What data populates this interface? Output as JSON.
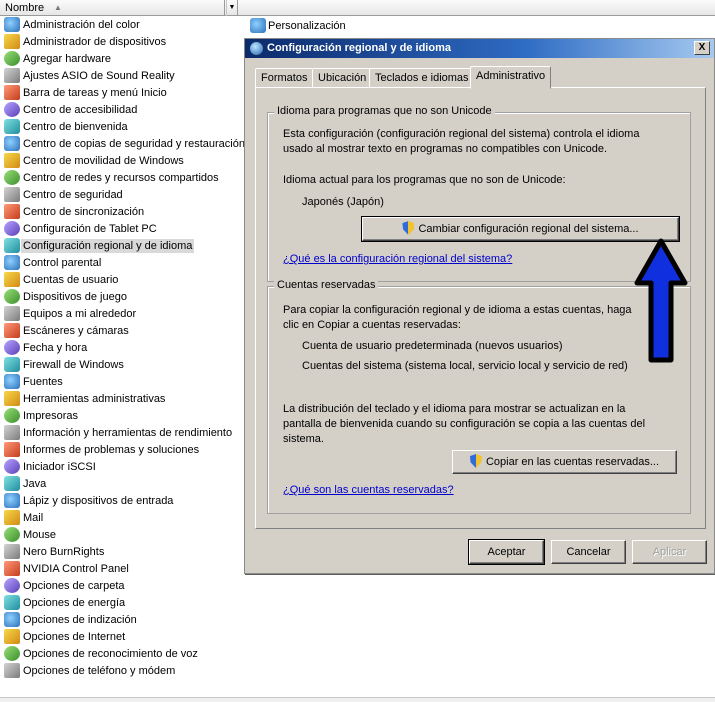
{
  "column_header": {
    "name_label": "Nombre",
    "sort_indicator": "▲",
    "dropdown_glyph": "▼"
  },
  "explorer_items": [
    {
      "label": "Administración del color",
      "icon": "color-icon"
    },
    {
      "label": "Administrador de dispositivos",
      "icon": "device-manager-icon"
    },
    {
      "label": "Agregar hardware",
      "icon": "add-hardware-icon"
    },
    {
      "label": "Ajustes ASIO de Sound Reality",
      "icon": "asio-icon"
    },
    {
      "label": "Barra de tareas y menú Inicio",
      "icon": "taskbar-icon"
    },
    {
      "label": "Centro de accesibilidad",
      "icon": "accessibility-icon"
    },
    {
      "label": "Centro de bienvenida",
      "icon": "welcome-icon"
    },
    {
      "label": "Centro de copias de seguridad y restauración",
      "icon": "backup-icon"
    },
    {
      "label": "Centro de movilidad de Windows",
      "icon": "mobility-icon"
    },
    {
      "label": "Centro de redes y recursos compartidos",
      "icon": "network-icon"
    },
    {
      "label": "Centro de seguridad",
      "icon": "security-icon"
    },
    {
      "label": "Centro de sincronización",
      "icon": "sync-icon"
    },
    {
      "label": "Configuración de Tablet PC",
      "icon": "tablet-icon"
    },
    {
      "label": "Configuración regional y de idioma",
      "icon": "globe-icon",
      "selected": true
    },
    {
      "label": "Control parental",
      "icon": "parental-icon"
    },
    {
      "label": "Cuentas de usuario",
      "icon": "users-icon"
    },
    {
      "label": "Dispositivos de juego",
      "icon": "gamepad-icon"
    },
    {
      "label": "Equipos a mi alrededor",
      "icon": "people-near-icon"
    },
    {
      "label": "Escáneres y cámaras",
      "icon": "scanner-icon"
    },
    {
      "label": "Fecha y hora",
      "icon": "clock-icon"
    },
    {
      "label": "Firewall de Windows",
      "icon": "firewall-icon"
    },
    {
      "label": "Fuentes",
      "icon": "fonts-icon"
    },
    {
      "label": "Herramientas administrativas",
      "icon": "admin-tools-icon"
    },
    {
      "label": "Impresoras",
      "icon": "printer-icon"
    },
    {
      "label": "Información y herramientas de rendimiento",
      "icon": "performance-icon"
    },
    {
      "label": "Informes de problemas y soluciones",
      "icon": "problem-reports-icon"
    },
    {
      "label": "Iniciador iSCSI",
      "icon": "iscsi-icon"
    },
    {
      "label": "Java",
      "icon": "java-icon"
    },
    {
      "label": "Lápiz y dispositivos de entrada",
      "icon": "pen-icon"
    },
    {
      "label": "Mail",
      "icon": "mail-icon"
    },
    {
      "label": "Mouse",
      "icon": "mouse-icon"
    },
    {
      "label": "Nero BurnRights",
      "icon": "nero-icon"
    },
    {
      "label": "NVIDIA Control Panel",
      "icon": "nvidia-icon"
    },
    {
      "label": "Opciones de carpeta",
      "icon": "folder-icon"
    },
    {
      "label": "Opciones de energía",
      "icon": "power-icon"
    },
    {
      "label": "Opciones de indización",
      "icon": "indexing-icon"
    },
    {
      "label": "Opciones de Internet",
      "icon": "internet-icon"
    },
    {
      "label": "Opciones de reconocimiento de voz",
      "icon": "microphone-icon"
    },
    {
      "label": "Opciones de teléfono y módem",
      "icon": "phone-icon"
    }
  ],
  "right_column_item": {
    "label": "Personalización",
    "icon": "personalization-icon"
  },
  "dialog": {
    "title": "Configuración regional y de idioma",
    "close_glyph": "X",
    "tabs": [
      "Formatos",
      "Ubicación",
      "Teclados e idiomas",
      "Administrativo"
    ],
    "active_tab": "Administrativo",
    "unicode_group": {
      "title": "Idioma para programas que no son Unicode",
      "desc_line1": "Esta configuración (configuración regional del sistema) controla el idioma",
      "desc_line2": "usado al mostrar texto en programas no compatibles con Unicode.",
      "current_label": "Idioma actual para los programas que no son de Unicode:",
      "current_value": "Japonés (Japón)",
      "change_button": "Cambiar configuración regional del sistema...",
      "help_link": "¿Qué es la configuración regional del sistema?"
    },
    "reserved_group": {
      "title": "Cuentas reservadas",
      "desc_line1": "Para copiar la configuración regional y de idioma a estas cuentas, haga",
      "desc_line2": "clic en Copiar a cuentas reservadas:",
      "account1": "Cuenta de usuario predeterminada (nuevos usuarios)",
      "account2": "Cuentas del sistema (sistema local, servicio local y servicio de red)",
      "note_line1": "La distribución del teclado y el idioma para mostrar se actualizan en la",
      "note_line2": "pantalla de bienvenida cuando su configuración se copia a las cuentas del",
      "note_line3": "sistema.",
      "copy_button": "Copiar en las cuentas reservadas...",
      "help_link": "¿Qué son las cuentas reservadas?"
    },
    "buttons": {
      "ok": "Aceptar",
      "cancel": "Cancelar",
      "apply": "Aplicar"
    }
  },
  "annotation_arrow": {
    "color": "#1030e0",
    "outline": "#000000",
    "direction": "up"
  }
}
